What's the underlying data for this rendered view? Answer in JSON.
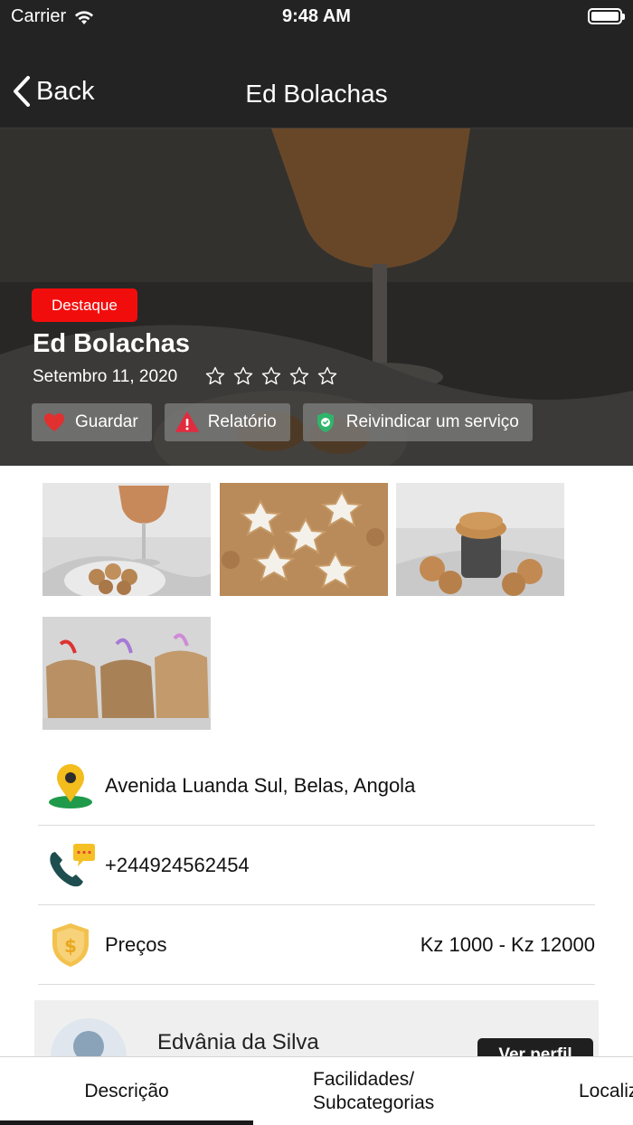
{
  "status_bar": {
    "carrier": "Carrier",
    "time": "9:48 AM"
  },
  "nav": {
    "back_label": "Back",
    "title": "Ed Bolachas"
  },
  "hero": {
    "badge": "Destaque",
    "title": "Ed Bolachas",
    "date": "Setembro 11, 2020",
    "rating": 0,
    "rating_max": 5,
    "actions": [
      {
        "label": "Guardar",
        "icon": "heart-icon"
      },
      {
        "label": "Relatório",
        "icon": "warning-icon"
      },
      {
        "label": "Reivindicar um serviço",
        "icon": "shield-check-icon"
      }
    ]
  },
  "gallery": [
    "juice-glass-cookies-photo",
    "star-cookies-photo",
    "stacked-cookies-photo",
    "cookie-bags-photo"
  ],
  "info": {
    "address": "Avenida Luanda Sul, Belas, Angola",
    "phone": "+244924562454",
    "price_label": "Preços",
    "price_value": "Kz 1000 - Kz 12000"
  },
  "author": {
    "name": "Edvânia da Silva",
    "profile_button": "Ver perfil"
  },
  "tabs": [
    {
      "label": "Descrição",
      "active": true
    },
    {
      "label_line1": "Facilidades/",
      "label_line2": "Subcategorias",
      "active": false
    },
    {
      "label": "Localização",
      "active": false
    }
  ],
  "colors": {
    "badge": "#f20d0d",
    "nav_bg": "#232323",
    "heart": "#e03030",
    "warning": "#e32b3f",
    "shield": "#2fb56a"
  }
}
